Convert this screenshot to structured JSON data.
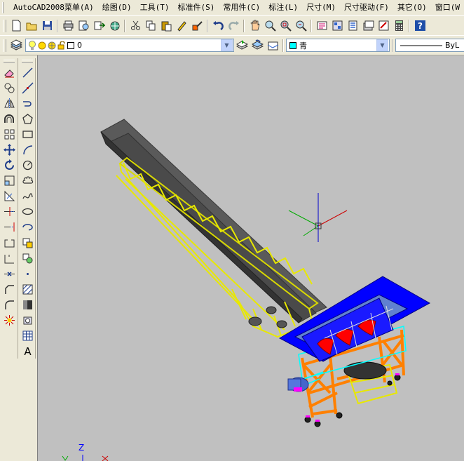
{
  "menubar": {
    "items": [
      "AutoCAD2008菜单(A)",
      "绘图(D)",
      "工具(T)",
      "标准件(S)",
      "常用件(C)",
      "标注(L)",
      "尺寸(M)",
      "尺寸驱动(F)",
      "其它(O)",
      "窗口(W"
    ]
  },
  "layer_bar": {
    "layer_name": "0",
    "color_name": "青",
    "linetype_name": "ByL"
  },
  "standard_toolbar": {
    "icons": [
      "new-icon",
      "open-icon",
      "save-icon",
      "print-icon",
      "preview-icon",
      "publish-icon",
      "3d-publish-icon",
      "cut-icon",
      "copy-icon",
      "paste-icon",
      "match-properties-icon",
      "block-editor-icon",
      "undo-icon",
      "redo-icon",
      "pan-icon",
      "zoom-realtime-icon",
      "zoom-window-icon",
      "zoom-previous-icon",
      "properties-icon",
      "design-center-icon",
      "tool-palettes-icon",
      "sheet-set-icon",
      "markup-icon",
      "calculator-icon",
      "help-icon"
    ]
  },
  "ucs_icon": {
    "z_label": "Z"
  },
  "colors": {
    "viewport_bg": "#c0c0c0",
    "frame_yellow": "#e8e800",
    "belt_gray": "#5a5a5a",
    "hopper_blue": "#0000ff",
    "base_orange": "#ff8000",
    "accent_red": "#ff0000",
    "cyan": "#00ffff"
  }
}
